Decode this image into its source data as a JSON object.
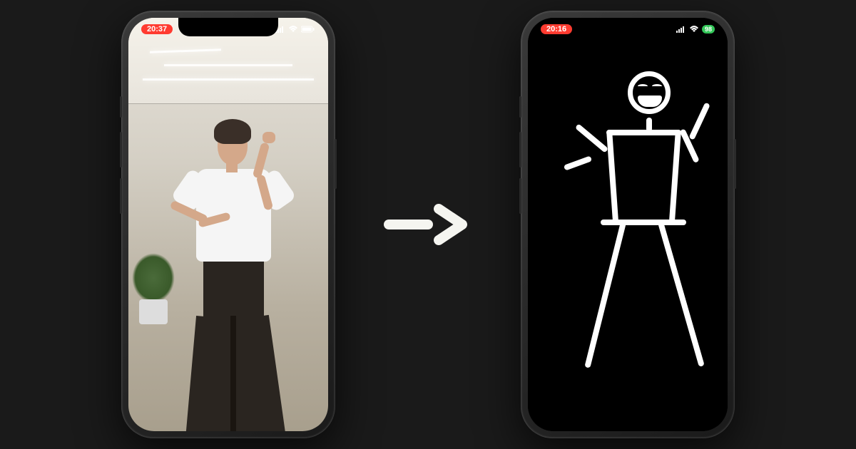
{
  "left_phone": {
    "status": {
      "time": "20:37"
    }
  },
  "right_phone": {
    "status": {
      "time": "20:16",
      "battery": "98"
    }
  },
  "colors": {
    "background": "#1a1a1a",
    "recording_pill": "#ff3b30",
    "battery_pill": "#34c759"
  }
}
